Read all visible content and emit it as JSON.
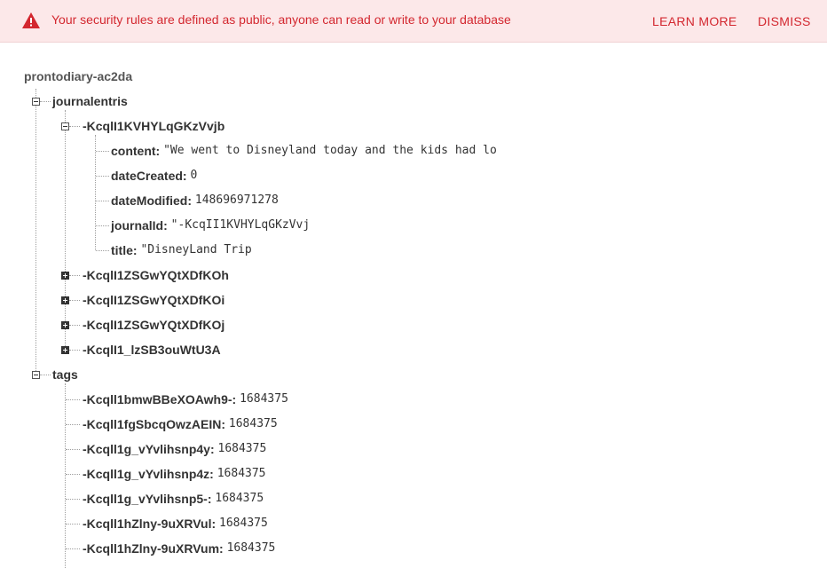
{
  "banner": {
    "message": "Your security rules are defined as public, anyone can read or write to your database",
    "learn_more": "LEARN MORE",
    "dismiss": "DISMISS",
    "icon": "warning-icon",
    "color": "#d3272f"
  },
  "tree": {
    "root": "prontodiary-ac2da",
    "journal": {
      "key": "journalentris",
      "expanded_entry": {
        "key": "-KcqlI1KVHYLqGKzVvjb",
        "fields": [
          {
            "key": "content:",
            "value": "\"We went to Disneyland today and the kids had lo"
          },
          {
            "key": "dateCreated:",
            "value": "0"
          },
          {
            "key": "dateModified:",
            "value": "148696971278"
          },
          {
            "key": "journalId:",
            "value": "\"-KcqII1KVHYLqGKzVvj"
          },
          {
            "key": "title:",
            "value": "\"DisneyLand Trip"
          }
        ]
      },
      "collapsed_entries": [
        "-KcqlI1ZSGwYQtXDfKOh",
        "-KcqlI1ZSGwYQtXDfKOi",
        "-KcqlI1ZSGwYQtXDfKOj",
        "-KcqlI1_lzSB3ouWtU3A"
      ]
    },
    "tags": {
      "key": "tags",
      "items": [
        {
          "key": "-Kcqll1bmwBBeXOAwh9-:",
          "value": "1684375"
        },
        {
          "key": "-Kcqll1fgSbcqOwzAEIN:",
          "value": "1684375"
        },
        {
          "key": "-Kcqll1g_vYvlihsnp4y:",
          "value": "1684375"
        },
        {
          "key": "-Kcqll1g_vYvlihsnp4z:",
          "value": "1684375"
        },
        {
          "key": "-Kcqll1g_vYvlihsnp5-:",
          "value": "1684375"
        },
        {
          "key": "-Kcqll1hZlny-9uXRVul:",
          "value": "1684375"
        },
        {
          "key": "-Kcqll1hZlny-9uXRVum:",
          "value": "1684375"
        }
      ]
    }
  }
}
